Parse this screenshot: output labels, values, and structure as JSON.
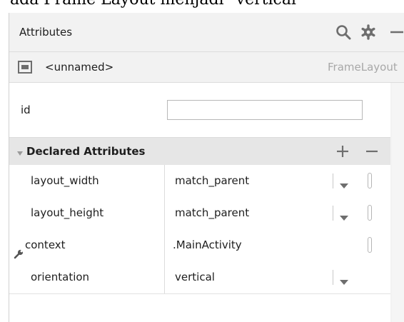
{
  "page_heading_fragment": "ada Frame Layout menjadi \"vertical\"",
  "panel": {
    "title": "Attributes",
    "toolbar_icons": [
      "search-icon",
      "gear-icon",
      "minimize-icon"
    ]
  },
  "component": {
    "name": "<unnamed>",
    "type": "FrameLayout"
  },
  "id_field": {
    "label": "id",
    "value": ""
  },
  "declared": {
    "title": "Declared Attributes",
    "add_symbol": "+",
    "remove_symbol": "−",
    "rows": [
      {
        "name": "layout_width",
        "value": "match_parent",
        "has_dropdown": true,
        "has_pill": true,
        "has_wrench": false
      },
      {
        "name": "layout_height",
        "value": "match_parent",
        "has_dropdown": true,
        "has_pill": true,
        "has_wrench": false
      },
      {
        "name": "context",
        "value": ".MainActivity",
        "has_dropdown": false,
        "has_pill": true,
        "has_wrench": true
      },
      {
        "name": "orientation",
        "value": "vertical",
        "has_dropdown": true,
        "has_pill": false,
        "has_wrench": false
      }
    ]
  },
  "colors": {
    "panel_bg": "#f2f2f2",
    "section_bg": "#e6e6e6",
    "muted_text": "#a8a8a8",
    "icon_gray": "#6e6e6e"
  }
}
